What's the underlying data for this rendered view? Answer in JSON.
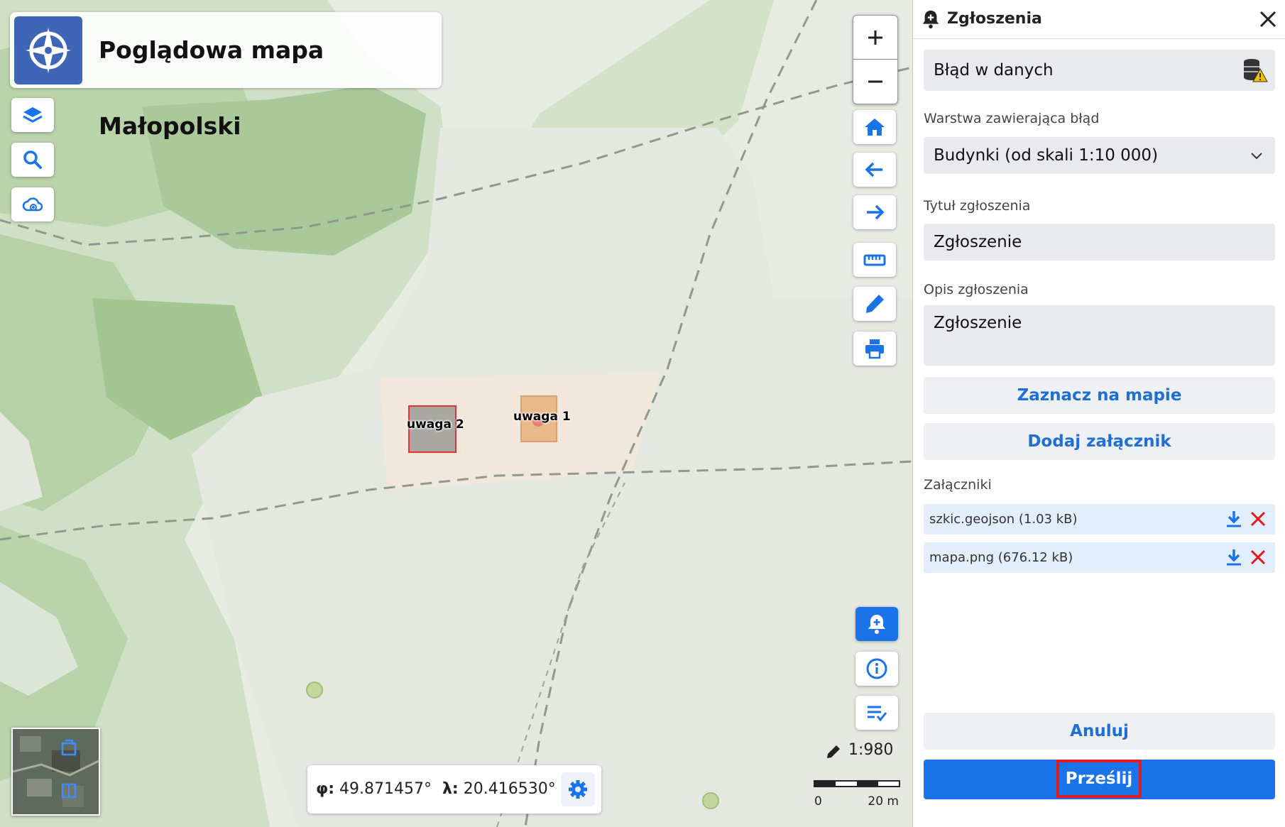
{
  "app": {
    "title": "Poglądowa mapa Małopolski"
  },
  "map": {
    "labels": {
      "feature_1": "uwaga 1",
      "feature_2": "uwaga 2"
    },
    "coords": {
      "lat_label": "φ:",
      "lat_value": "49.871457°",
      "lon_label": "λ:",
      "lon_value": "20.416530°"
    },
    "scale": {
      "ratio": "1:980",
      "bar_start": "0",
      "bar_end": "20 m"
    }
  },
  "toolbar": {
    "zoom_in": "+",
    "zoom_out": "−"
  },
  "panel": {
    "title": "Zgłoszenia",
    "type_value": "Błąd w danych",
    "layer_label": "Warstwa zawierająca błąd",
    "layer_value": "Budynki (od skali 1:10 000)",
    "title_label": "Tytuł zgłoszenia",
    "title_value": "Zgłoszenie",
    "desc_label": "Opis zgłoszenia",
    "desc_value": "Zgłoszenie",
    "mark_on_map": "Zaznacz na mapie",
    "add_attachment": "Dodaj załącznik",
    "attachments_label": "Załączniki",
    "attachments": [
      {
        "name": "szkic.geojson (1.03 kB)"
      },
      {
        "name": "mapa.png (676.12 kB)"
      }
    ],
    "cancel": "Anuluj",
    "submit": "Prześlij"
  },
  "colors": {
    "accent": "#1a73e8",
    "danger": "#e01b1b",
    "brand": "#3f66b6"
  }
}
